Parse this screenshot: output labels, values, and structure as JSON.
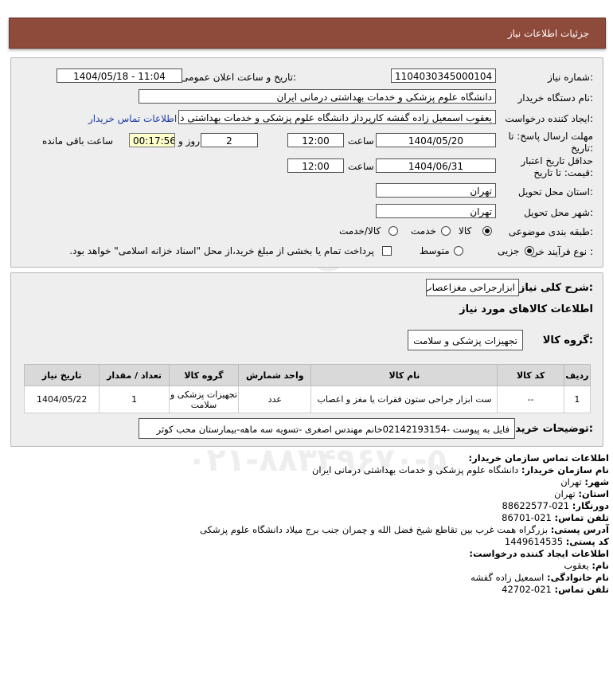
{
  "header": {
    "title": "جزئیات اطلاعات نیاز"
  },
  "form": {
    "need_number": {
      "label": "شماره نیاز:",
      "value": "1104030345000104"
    },
    "announce": {
      "label": "تاریخ و ساعت اعلان عمومی:",
      "value": "1404/05/18 - 11:04"
    },
    "buyer_org": {
      "label": "نام دستگاه خریدار:",
      "value": "دانشگاه علوم پزشکی و خدمات بهداشتی درمانی ایران"
    },
    "requester": {
      "label": "ایجاد کننده درخواست:",
      "value": "یعقوب اسمعیل زاده گفشه کارپرداز دانشگاه علوم پزشکی و خدمات بهداشتی د",
      "link": "اطلاعات تماس خریدار"
    },
    "deadline": {
      "label_line1": "مهلت ارسال پاسخ: تا",
      "label_line2": "تاریخ:",
      "date": "1404/05/20",
      "time_label": "ساعت",
      "time": "12:00",
      "days": "2",
      "days_label": "روز و",
      "remaining": "00:17:56",
      "remaining_label": "ساعت باقی مانده"
    },
    "validity": {
      "label_line1": "حداقل تاریخ اعتبار",
      "label_line2": "قیمت: تا تاریخ:",
      "date": "1404/06/31",
      "time_label": "ساعت",
      "time": "12:00"
    },
    "province": {
      "label": "استان محل تحویل:",
      "value": "تهران"
    },
    "city": {
      "label": "شهر محل تحویل:",
      "value": "تهران"
    },
    "category": {
      "label": "طبقه بندی موضوعی:",
      "options": [
        "کالا",
        "خدمت",
        "کالا/خدمت"
      ],
      "selected": "کالا"
    },
    "purchase_type": {
      "label": "نوع فرآیند خرید :",
      "options": [
        "جزیی",
        "متوسط"
      ],
      "selected": "جزیی",
      "checkbox_text": "پرداخت تمام یا بخشی از مبلغ خرید،از محل \"اسناد خزانه اسلامی\" خواهد بود."
    }
  },
  "description": {
    "label": "شرح کلی نیاز:",
    "value": "ابزارجراحی مغزاعصاب",
    "goods_info_title": "اطلاعات کالاهای مورد نیاز",
    "goods_group_label": "گروه کالا:",
    "goods_group_value": "تجهیزات پزشکی و سلامت"
  },
  "table": {
    "headers": [
      "ردیف",
      "کد کالا",
      "نام کالا",
      "واحد شمارش",
      "گروه کالا",
      "تعداد / مقدار",
      "تاریخ نیاز"
    ],
    "rows": [
      [
        "1",
        "--",
        "ست ابزار جراحی ستون فقرات یا مغز و اعصاب",
        "عدد",
        "تجهیزات پزشکی و سلامت",
        "1",
        "1404/05/22"
      ]
    ]
  },
  "buyer_notes": {
    "label": "توضیحات خریدار:",
    "value": "فایل به پیوست -02142193154خانم مهندس اصغری -تسویه سه ماهه-بیمارستان محب کوثر"
  },
  "contact": {
    "org_title": "اطلاعات تماس سازمان خریدار:",
    "buyer_name_label": "نام سازمان خریدار:",
    "buyer_name": "دانشگاه علوم پزشکی و خدمات بهداشتی درمانی ایران",
    "city_label": "شهر:",
    "city": "تهران",
    "province_label": "استان:",
    "province": "تهران",
    "fax_label": "دورنگار:",
    "fax": "021-88622577",
    "phone_label": "تلفن تماس:",
    "phone": "021-86701",
    "address_label": "آدرس پستی:",
    "address": "بزرگراه همت غرب بین تقاطع شیخ فضل الله و چمران جنب برج میلاد دانشگاه علوم پزشکی",
    "postal_label": "کد پستی:",
    "postal": "1449614535",
    "creator_title": "اطلاعات ایجاد کننده درخواست:",
    "first_name_label": "نام:",
    "first_name": "یعقوب",
    "last_name_label": "نام خانوادگی:",
    "last_name": "اسمعیل زاده گفشه",
    "creator_phone_label": "تلفن تماس:",
    "creator_phone": "021-42702"
  },
  "watermark": {
    "brand": "ParsNamadData",
    "phone": "۰۲۱-۸۸۳۴۹۶۷۰-۵"
  }
}
